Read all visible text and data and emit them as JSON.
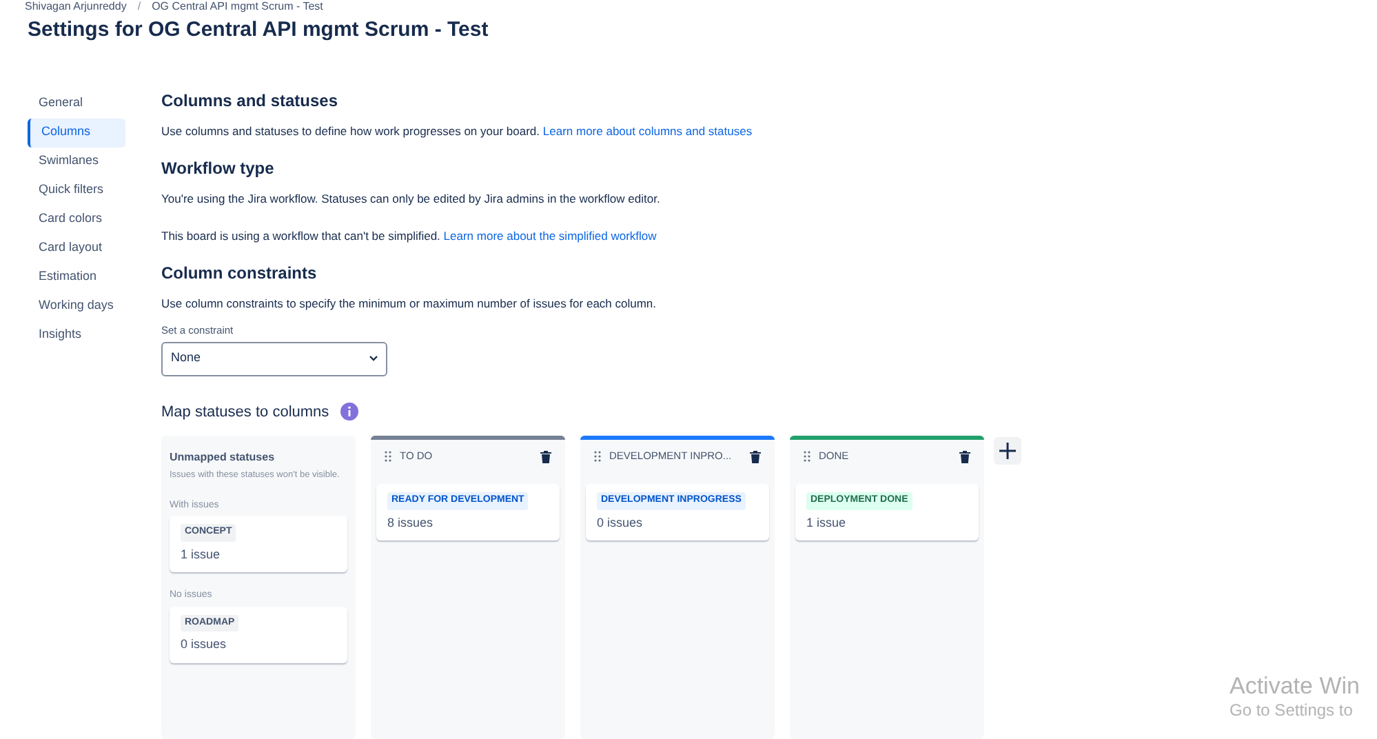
{
  "breadcrumbs": [
    {
      "kind": "link",
      "text": "Shivagan Arjunreddy"
    },
    {
      "kind": "separator",
      "text": "/"
    },
    {
      "kind": "link",
      "text": "OG Central API mgmt Scrum - Test"
    }
  ],
  "title": "Settings for OG Central API mgmt Scrum - Test",
  "sidebar": {
    "items": [
      {
        "label": "General",
        "selected": false
      },
      {
        "label": "Columns",
        "selected": true
      },
      {
        "label": "Swimlanes",
        "selected": false
      },
      {
        "label": "Quick filters",
        "selected": false
      },
      {
        "label": "Card colors",
        "selected": false
      },
      {
        "label": "Card layout",
        "selected": false
      },
      {
        "label": "Estimation",
        "selected": false
      },
      {
        "label": "Working days",
        "selected": false
      },
      {
        "label": "Insights",
        "selected": false
      }
    ]
  },
  "sections": [
    {
      "heading": "Columns and statuses",
      "paragraphs": [
        {
          "text": "Use columns and statuses to define how work progresses on your board.",
          "link": "Learn more about columns and statuses"
        }
      ]
    },
    {
      "heading": "Workflow type",
      "paragraphs": [
        {
          "text": "You're using the Jira workflow. Statuses can only be edited by Jira admins in the workflow editor."
        },
        {
          "text": "This board is using a workflow that can't be simplified.",
          "link": "Learn more about the simplified workflow"
        }
      ]
    },
    {
      "heading": "Column constraints",
      "paragraphs": [
        {
          "text": "Use column constraints to specify the minimum or maximum number of issues for each column."
        }
      ]
    }
  ],
  "constraint": {
    "label": "Set a constraint",
    "value": "None"
  },
  "map_heading": "Map statuses to columns",
  "unmapped": {
    "title": "Unmapped statuses",
    "description": "Issues with these statuses won't be visible.",
    "groups": [
      {
        "label": "With issues",
        "statuses": [
          {
            "name": "CONCEPT",
            "kind": "grey",
            "count": "1 issue"
          }
        ]
      },
      {
        "label": "No issues",
        "statuses": [
          {
            "name": "ROADMAP",
            "kind": "grey",
            "count": "0 issues"
          }
        ]
      }
    ]
  },
  "columns": [
    {
      "name": "TO DO",
      "color": "#758195",
      "statuses": [
        {
          "name": "READY FOR DEVELOPMENT",
          "kind": "blue",
          "count": "8 issues"
        }
      ]
    },
    {
      "name": "DEVELOPMENT INPRO...",
      "color": "#1d7afc",
      "statuses": [
        {
          "name": "DEVELOPMENT INPROGRESS",
          "kind": "blue",
          "count": "0 issues"
        }
      ]
    },
    {
      "name": "DONE",
      "color": "#22a06b",
      "statuses": [
        {
          "name": "DEPLOYMENT DONE",
          "kind": "green",
          "count": "1 issue"
        }
      ]
    }
  ],
  "os_notice": {
    "title": "Activate Win",
    "subtitle": "Go to Settings to"
  }
}
